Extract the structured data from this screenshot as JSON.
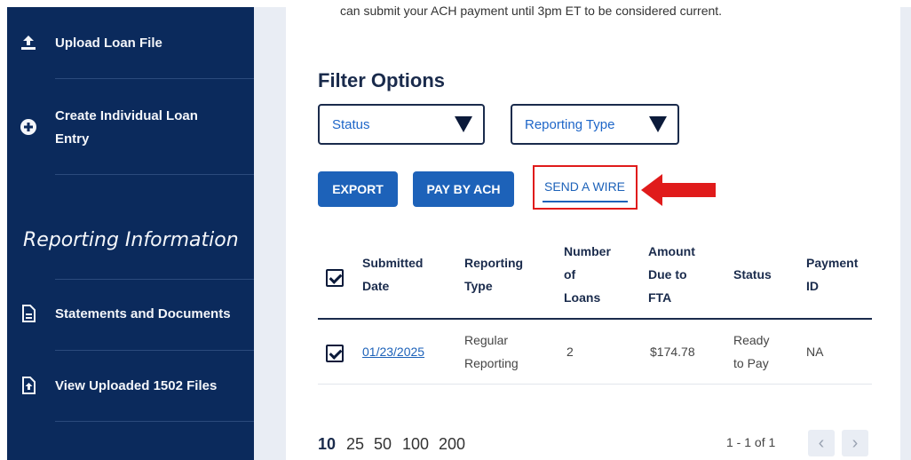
{
  "notice": "can submit your ACH payment until 3pm ET to be considered current.",
  "sidebar": {
    "items": [
      {
        "icon": "upload-icon",
        "label": "Upload Loan File"
      },
      {
        "icon": "plus-circle-icon",
        "label_line1": "Create Individual Loan",
        "label_line2": "Entry"
      },
      {
        "icon": "document-icon",
        "label": "Statements and Documents"
      },
      {
        "icon": "file-upload-icon",
        "label": "View Uploaded 1502 Files"
      }
    ],
    "section_title": "Reporting Information"
  },
  "filters": {
    "title": "Filter Options",
    "status": "Status",
    "reporting_type": "Reporting Type"
  },
  "actions": {
    "export": "EXPORT",
    "pay_by_ach": "PAY BY ACH",
    "send_a_wire": "SEND A WIRE"
  },
  "table": {
    "headers": {
      "submitted_date": [
        "Submitted",
        "Date"
      ],
      "reporting_type": [
        "Reporting",
        "Type"
      ],
      "number_of_loans": [
        "Number",
        "of",
        "Loans"
      ],
      "amount_due": [
        "Amount",
        "Due to",
        "FTA"
      ],
      "status": [
        "Status"
      ],
      "payment_id": [
        "Payment",
        "ID"
      ]
    },
    "rows": [
      {
        "submitted_date": "01/23/2025",
        "reporting_type": [
          "Regular",
          "Reporting"
        ],
        "number_of_loans": "2",
        "amount_due": "$174.78",
        "status": [
          "Ready",
          "to Pay"
        ],
        "payment_id": "NA",
        "checked": true
      }
    ]
  },
  "pagination": {
    "sizes": [
      "10",
      "25",
      "50",
      "100",
      "200"
    ],
    "selected": "10",
    "range": "1 - 1 of 1"
  },
  "colors": {
    "sidebar": "#0b2a5c",
    "primary": "#1d62b9",
    "highlight": "#e01b1b"
  }
}
